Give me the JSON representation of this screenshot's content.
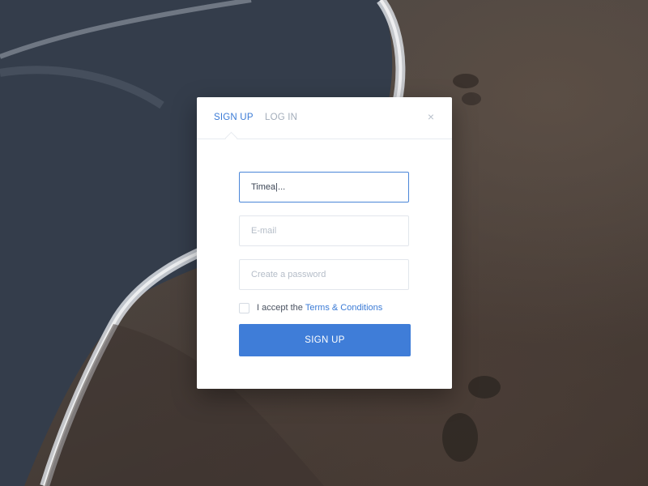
{
  "tabs": {
    "signup": "SIGN UP",
    "login": "LOG IN",
    "active": "signup"
  },
  "close_icon": "close-icon",
  "close_glyph": "×",
  "form": {
    "name_value": "Timea|...",
    "email_placeholder": "E-mail",
    "password_placeholder": "Create a password",
    "accept_text": "I accept the",
    "terms_link": "Terms & Conditions",
    "submit_label": "SIGN UP"
  },
  "colors": {
    "accent": "#3f7dd8",
    "tab_inactive": "#a3adba",
    "modal_bg": "#ffffff"
  }
}
